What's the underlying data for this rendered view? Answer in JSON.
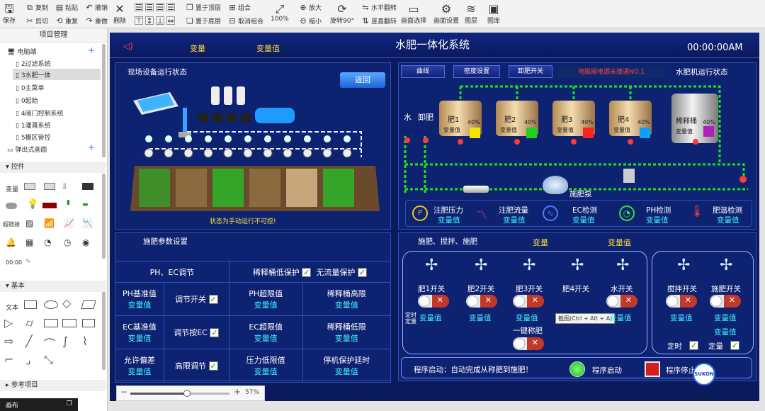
{
  "toolbar": {
    "save": "保存",
    "copy": "复制",
    "paste": "粘贴",
    "undo": "撤销",
    "cut": "剪切",
    "redo": "重复",
    "redo2": "重做",
    "delete": "删除",
    "bring_top": "置于顶层",
    "bring_bottom": "置于底层",
    "group": "组合",
    "ungroup": "取消组合",
    "zoom": "100%",
    "zoom_in": "放大",
    "zoom_out": "缩小",
    "rotate": "旋转90°",
    "hflip": "水平翻转",
    "vflip": "竖直翻转",
    "select": "画面选择",
    "settings": "画面设置",
    "layers": "图层",
    "gallery": "图库"
  },
  "left": {
    "title": "项目管理",
    "root": "电脑端",
    "items": [
      "2过滤系统",
      "3水肥一体",
      "0主菜单",
      "0起始",
      "4阀门控制系统",
      "1灌溉系统",
      "5棚区管控"
    ],
    "popup": "弹出式画面",
    "controls_head": "控件",
    "ctrl_labels": {
      "var": "变量",
      "link": "超链接",
      "time": "00:00"
    },
    "basic_head": "基本",
    "text_label": "文本",
    "ref_head": "参考项目",
    "bottom": "画布"
  },
  "hmi": {
    "title": "水肥一体化系统",
    "clock": "00:00:00AM",
    "var1": "变量",
    "var2": "变量值",
    "status_title": "现场设备运行状态",
    "back": "返回",
    "status_msg": "状态为手动运行不可控!",
    "tabs": [
      "曲线",
      "密度设置",
      "卸肥开关"
    ],
    "alarm": "电磁阀电源未接通NO.1",
    "run_state": "水肥机运行状态",
    "water": "水",
    "unload": "卸肥",
    "tanks": [
      {
        "name": "肥1",
        "pct": "40%",
        "color": "#f2e600"
      },
      {
        "name": "肥2",
        "pct": "40%",
        "color": "#1fd11f"
      },
      {
        "name": "肥3",
        "pct": "40%",
        "color": "#ff2020"
      },
      {
        "name": "肥4",
        "pct": "40%",
        "color": "#0aa0ff"
      }
    ],
    "dilute": "稀释桶",
    "dilute_pct": "40%",
    "dilute_color": "#b020c0",
    "tank_var": "变量值",
    "pump": "施肥泵",
    "gauges": [
      {
        "label": "注肥压力",
        "val": "变量值"
      },
      {
        "label": "注肥流量",
        "val": "变量值"
      },
      {
        "label": "EC检测",
        "val": "变量值"
      },
      {
        "label": "PH检测",
        "val": "变量值"
      },
      {
        "label": "肥温检测",
        "val": "变量值"
      }
    ],
    "param_title": "施肥参数设置",
    "params": {
      "ph_ec": "PH、EC调节",
      "dilute_low": "稀释桶低保护",
      "no_flow": "无流量保护",
      "ph_base": "PH基准值",
      "ph_base_v": "变量值",
      "adj_switch": "调节开关",
      "ph_limit": "PH超限值",
      "ph_limit_v": "变量值",
      "dilute_high": "稀释桶高限",
      "dilute_high_v": "变量值",
      "ec_base": "EC基准值",
      "ec_base_v": "变量值",
      "adj_ec": "调节按EC",
      "ec_limit": "EC超限值",
      "ec_limit_v": "变量值",
      "dilute_lowl": "稀释桶低限",
      "dilute_lowl_v": "变量值",
      "allow_dev": "允许偏差",
      "allow_dev_v": "变量值",
      "high_adj": "高限调节",
      "press_limit": "压力低限值",
      "press_limit_v": "变量值",
      "stop_delay": "停机保护延时",
      "stop_delay_v": "变量值"
    },
    "mix_title": "施肥、搅拌、施肥",
    "mix_var1": "变量",
    "mix_var2": "变量值",
    "switches": [
      {
        "label": "肥1开关",
        "val": "变量值"
      },
      {
        "label": "肥2开关",
        "val": "变量值"
      },
      {
        "label": "肥3开关",
        "val": "变量值"
      },
      {
        "label": "肥4开关",
        "val": "变量值"
      },
      {
        "label": "水开关",
        "val": "变量值"
      }
    ],
    "timing": "定时\n定量",
    "one_key": "一键称肥",
    "tooltip": "截图(Ctrl + Alt + A)",
    "stir": "搅拌开关",
    "stir_val": "变量值",
    "apply": "施肥开关",
    "apply_val": "变量值",
    "apply_val2": "变量值",
    "timed": "定时",
    "quant": "定量",
    "prog_msg": "程序启动：自动完成从称肥到施肥！",
    "prog_start": "程序启动",
    "prog_stop": "程序停止",
    "logo": "SUKON"
  },
  "zoom_pct": "57%",
  "colors": {
    "hmi_bg": "#0b1a5c",
    "accent": "#3df3ff",
    "pipe": "#19e619"
  }
}
